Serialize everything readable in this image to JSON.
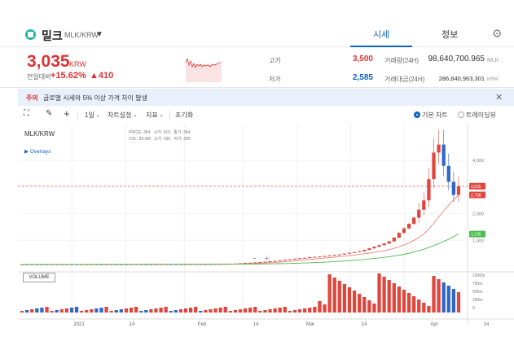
{
  "header": {
    "coin_name": "밀크",
    "pair": "MLK/KRW",
    "tabs": [
      {
        "label": "시세",
        "active": true
      },
      {
        "label": "정보",
        "active": false
      }
    ]
  },
  "price": {
    "value": "3,035",
    "unit": "KRW",
    "change_label": "전일대비",
    "change_rate": "+15.62%",
    "change_amount": "▲410"
  },
  "stats": {
    "high_label": "고가",
    "high_value": "3,500",
    "low_label": "저가",
    "low_value": "2,585",
    "volume_label": "거래량(24H)",
    "volume_value": "98,640,700.965",
    "volume_unit": "MLK",
    "amount_label": "거래대금(24H)",
    "amount_value": "286,840,963,301",
    "amount_unit": "KRW"
  },
  "notice": {
    "tag": "주의",
    "text": "글로벌 시세와 5% 이상 가격 차이 발생"
  },
  "toolbar": {
    "period": "1일",
    "chart_settings": "차트설정",
    "indicators": "지표",
    "reset": "초기화",
    "mode_basic": "기본 차트",
    "mode_tradingview": "트레이딩뷰"
  },
  "chart": {
    "pair_label": "MLK/KRW",
    "overlays_label": "Overlays",
    "ohlc": {
      "price_label": "PRICE",
      "price_val": "364",
      "vol_label": "VOL",
      "vol_val": "89.0M",
      "open_label": "시가",
      "open_val": "419",
      "high_label": "고가",
      "high_val": "439",
      "low_label": "저가",
      "low_val": "309",
      "close_label": "종가",
      "close_val": "364"
    },
    "volume_label": "VOLUME",
    "y_ticks": [
      "4,000",
      "3,000",
      "2,000",
      "1,000"
    ],
    "y_markers": [
      {
        "label": "3,035",
        "color": "#e0463c"
      },
      {
        "label": "2,708",
        "color": "#e0463c"
      },
      {
        "label": "1,235",
        "color": "#28a745"
      }
    ],
    "vol_ticks": [
      "1000m",
      "750m",
      "500m",
      "250m",
      "0"
    ],
    "x_ticks": [
      "2021",
      "14",
      "Feb",
      "14",
      "Mar",
      "14",
      "Apr",
      "14"
    ],
    "colors": {
      "up": "#e0463c",
      "down": "#2f66c8",
      "ma_short": "#f08080",
      "ma_long": "#4cbb4c"
    }
  },
  "chart_data": {
    "type": "line",
    "ylim": [
      0,
      5200
    ],
    "candles_close": [
      96,
      95,
      96,
      95,
      94,
      95,
      96,
      95,
      96,
      97,
      96,
      95,
      96,
      97,
      98,
      97,
      96,
      97,
      98,
      97,
      96,
      97,
      98,
      99,
      98,
      97,
      98,
      99,
      100,
      101,
      100,
      99,
      100,
      101,
      102,
      103,
      101,
      102,
      104,
      106,
      108,
      112,
      118,
      125,
      138,
      150,
      160,
      170,
      180,
      195,
      210,
      230,
      250,
      270,
      290,
      310,
      330,
      345,
      364,
      380,
      390,
      410,
      430,
      450,
      470,
      500,
      530,
      560,
      590,
      640,
      700,
      760,
      820,
      880,
      960,
      1100,
      1280,
      1450,
      1620,
      1850,
      2150,
      2500,
      3300,
      4300,
      4600,
      3800,
      3200,
      2708,
      3035
    ],
    "ma_short": [
      96,
      96,
      96,
      96,
      96,
      96,
      96,
      96,
      96,
      96,
      96,
      96,
      96,
      96,
      97,
      97,
      97,
      97,
      97,
      97,
      97,
      97,
      97,
      97,
      98,
      98,
      98,
      98,
      98,
      99,
      99,
      99,
      99,
      100,
      100,
      100,
      101,
      101,
      101,
      102,
      103,
      104,
      106,
      108,
      112,
      117,
      123,
      130,
      138,
      147,
      158,
      170,
      183,
      197,
      212,
      228,
      245,
      262,
      280,
      298,
      316,
      334,
      352,
      370,
      388,
      407,
      427,
      448,
      470,
      494,
      520,
      548,
      578,
      612,
      650,
      700,
      760,
      830,
      910,
      1000,
      1110,
      1240,
      1420,
      1640,
      1880,
      2110,
      2320,
      2520,
      2708
    ],
    "ma_long": [
      95,
      95,
      95,
      95,
      95,
      95,
      95,
      95,
      95,
      95,
      95,
      95,
      95,
      95,
      95,
      96,
      96,
      96,
      96,
      96,
      96,
      96,
      96,
      96,
      96,
      97,
      97,
      97,
      97,
      97,
      97,
      98,
      98,
      98,
      98,
      98,
      99,
      99,
      99,
      100,
      100,
      101,
      101,
      102,
      103,
      104,
      106,
      108,
      110,
      113,
      116,
      119,
      123,
      127,
      132,
      137,
      143,
      149,
      156,
      164,
      172,
      181,
      191,
      201,
      212,
      224,
      237,
      251,
      266,
      282,
      299,
      318,
      338,
      360,
      384,
      410,
      440,
      475,
      515,
      560,
      610,
      665,
      730,
      800,
      880,
      960,
      1040,
      1140,
      1235
    ]
  }
}
